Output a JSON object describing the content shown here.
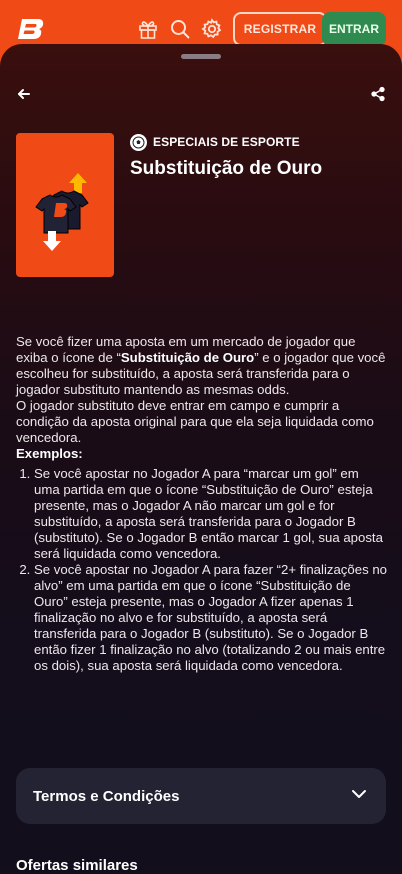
{
  "header": {
    "register_label": "REGISTRAR",
    "login_label": "ENTRAR",
    "icons": [
      "brand-logo",
      "gift-icon",
      "search-icon",
      "gear-icon"
    ]
  },
  "promo": {
    "category": "ESPECIAIS DE ESPORTE",
    "title": "Substituição de Ouro",
    "description_part1": "Se você fizer uma aposta em um mercado de jogador que exiba o ícone de “",
    "description_bold": "Substituição de Ouro",
    "description_part2": "” e o jogador que você escolheu for substituído, a aposta será transferida para o jogador substituto mantendo as mesmas odds.",
    "description_line2": "O jogador substituto deve entrar em campo e cumprir a condição da aposta original para que ela seja liquidada como vencedora.",
    "examples_label": "Exemplos:",
    "examples": [
      "Se você apostar no Jogador A para “marcar um gol” em uma partida em que o ícone “Substituição de Ouro” esteja presente, mas o Jogador A não marcar um gol e for substituído, a aposta será transferida para o Jogador B (substituto). Se o Jogador B então marcar 1 gol, sua aposta será liquidada como vencedora.",
      "Se você apostar no Jogador A para fazer “2+ finalizações no alvo” em uma partida em que o ícone “Substituição de Ouro” esteja presente, mas o Jogador A fizer apenas 1 finalização no alvo e for substituído, a aposta será transferida para o Jogador B (substituto). Se o Jogador B então fizer 1 finalização no alvo (totalizando 2 ou mais entre os dois), sua aposta será liquidada como vencedora."
    ]
  },
  "terms": {
    "label": "Termos e Condições"
  },
  "similar": {
    "label": "Ofertas similares"
  },
  "colors": {
    "brand": "#f04a16",
    "login_button": "#2f8a4f",
    "terms_bg": "#242333"
  }
}
